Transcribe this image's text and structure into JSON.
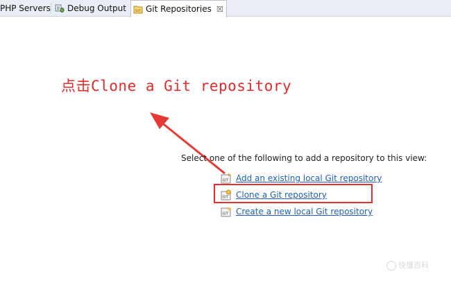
{
  "tabs": [
    {
      "label": "PHP Servers",
      "icon": "server-icon"
    },
    {
      "label": "Debug Output",
      "icon": "debug-icon"
    },
    {
      "label": "Git Repositories",
      "icon": "git-repository-icon",
      "active": true
    }
  ],
  "annotation": {
    "text": "点击Clone a Git repository",
    "color": "#e22b2b"
  },
  "view": {
    "instruction": "Select one of the following to add a repository to this view:",
    "actions": [
      {
        "label": "Add an existing local Git repository",
        "icon": "git-add-icon"
      },
      {
        "label": "Clone a Git repository",
        "icon": "git-clone-icon",
        "highlighted": true
      },
      {
        "label": "Create a new local Git repository",
        "icon": "git-create-icon"
      }
    ]
  },
  "watermark": {
    "text": "快懂百科"
  },
  "colors": {
    "link": "#1f5fb8",
    "annotation_red": "#e22b2b",
    "tabbar": "#e9eef6"
  }
}
